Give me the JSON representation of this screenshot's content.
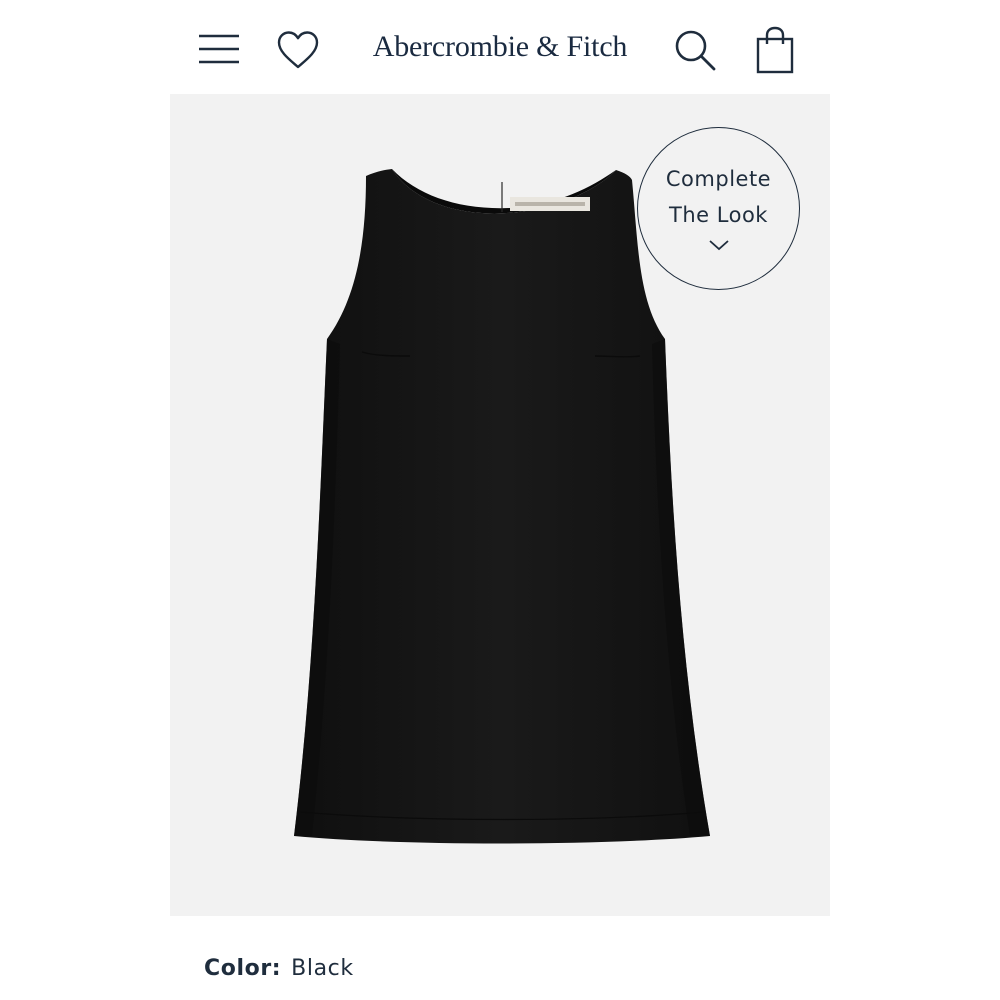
{
  "header": {
    "brand": "Abercrombie & Fitch",
    "icons": {
      "menu": "hamburger-menu-icon",
      "favorites": "heart-icon",
      "search": "search-icon",
      "bag": "shopping-bag-icon"
    }
  },
  "product": {
    "complete_look": {
      "line1": "Complete",
      "line2": "The Look",
      "icon": "chevron-down-icon"
    },
    "color_label": "Color:",
    "color_value": "Black"
  },
  "colors": {
    "brand_navy": "#1a2a40",
    "garment": "#141414",
    "hero_bg": "#f2f2f2"
  }
}
